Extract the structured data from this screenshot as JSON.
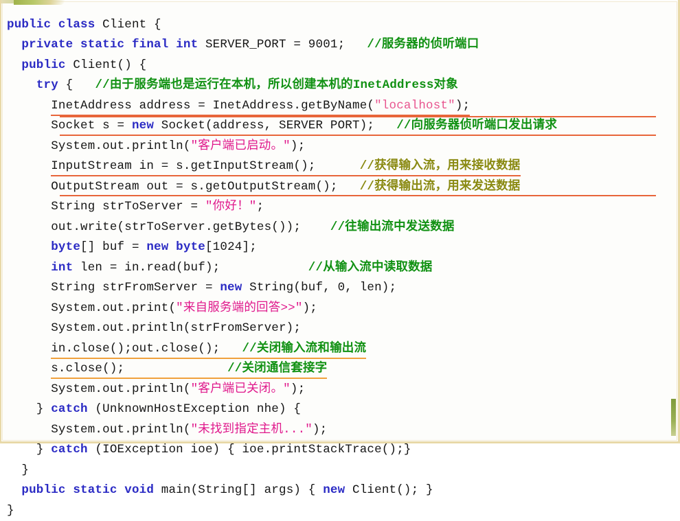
{
  "slide": {
    "language": "java",
    "class_name": "Client",
    "colors": {
      "background": "#fdfdfb",
      "border": "#e8d9a8",
      "keyword": "#2b2bc4",
      "string": "#e0198c",
      "comment_green": "#119113",
      "comment_olive": "#8a8a12",
      "underline_red": "#e8653a",
      "underline_orange": "#f0a13c",
      "accent_green": "#7f9b3c"
    }
  },
  "code": {
    "lines": [
      {
        "id": "line-class-decl",
        "indent": 0,
        "parts": [
          {
            "t": "public",
            "c": "kw"
          },
          {
            "t": " ",
            "c": "pl"
          },
          {
            "t": "class",
            "c": "kw"
          },
          {
            "t": " Client {",
            "c": "pl"
          }
        ]
      },
      {
        "id": "line-server-port",
        "indent": 1,
        "parts": [
          {
            "t": "private",
            "c": "kw"
          },
          {
            "t": " ",
            "c": "pl"
          },
          {
            "t": "static",
            "c": "kw"
          },
          {
            "t": " ",
            "c": "pl"
          },
          {
            "t": "final",
            "c": "kw"
          },
          {
            "t": " ",
            "c": "pl"
          },
          {
            "t": "int",
            "c": "kw"
          },
          {
            "t": " SERVER_PORT = 9001;   ",
            "c": "pl"
          },
          {
            "t": "//服务器的侦听端口",
            "c": "cmt-g"
          }
        ]
      },
      {
        "id": "line-ctor",
        "indent": 1,
        "parts": [
          {
            "t": "public",
            "c": "kw"
          },
          {
            "t": " Client() {",
            "c": "pl"
          }
        ]
      },
      {
        "id": "line-try",
        "indent": 2,
        "parts": [
          {
            "t": "try",
            "c": "kw"
          },
          {
            "t": " {   ",
            "c": "pl"
          },
          {
            "t": "//由于服务端也是运行在本机，所以创建本机的InetAddress对象",
            "c": "cmt-g"
          }
        ]
      },
      {
        "id": "line-inetaddress",
        "indent": 3,
        "underline": "red",
        "parts": [
          {
            "t": "InetAddress address = InetAddress.getByName(",
            "c": "pl"
          },
          {
            "t": "\"localhost\"",
            "c": "strl"
          },
          {
            "t": ");",
            "c": "pl"
          }
        ]
      },
      {
        "id": "line-socket",
        "indent": 3,
        "rule_top": true,
        "rule_bottom": true,
        "parts": [
          {
            "t": "Socket s = ",
            "c": "pl"
          },
          {
            "t": "new",
            "c": "kw"
          },
          {
            "t": " Socket(address, SERVER PORT);   ",
            "c": "pl"
          },
          {
            "t": "//向服务器侦听端口发出请求",
            "c": "cmt-g"
          }
        ]
      },
      {
        "id": "line-println-started",
        "indent": 3,
        "parts": [
          {
            "t": "System.out.println(",
            "c": "pl"
          },
          {
            "t": "\"客户端已启动。\"",
            "c": "str"
          },
          {
            "t": ");",
            "c": "pl"
          }
        ]
      },
      {
        "id": "line-inputstream",
        "indent": 3,
        "underline": "red",
        "parts": [
          {
            "t": "InputStream in = s.getInputStream();      ",
            "c": "pl"
          },
          {
            "t": "//获得输入流，用来接收数据",
            "c": "cmt-o"
          }
        ]
      },
      {
        "id": "line-outputstream",
        "indent": 3,
        "rule_bottom": true,
        "parts": [
          {
            "t": "OutputStream out = s.getOutputStream();   ",
            "c": "pl"
          },
          {
            "t": "//获得输出流，用来发送数据",
            "c": "cmt-o"
          }
        ]
      },
      {
        "id": "line-strtoserver",
        "indent": 3,
        "parts": [
          {
            "t": "String strToServer = ",
            "c": "pl"
          },
          {
            "t": "\"你好！\"",
            "c": "str"
          },
          {
            "t": ";",
            "c": "pl"
          }
        ]
      },
      {
        "id": "line-out-write",
        "indent": 3,
        "parts": [
          {
            "t": "out.write(strToServer.getBytes());    ",
            "c": "pl"
          },
          {
            "t": "//往输出流中发送数据",
            "c": "cmt-g"
          }
        ]
      },
      {
        "id": "line-buf",
        "indent": 3,
        "parts": [
          {
            "t": "byte",
            "c": "kw"
          },
          {
            "t": "[] buf = ",
            "c": "pl"
          },
          {
            "t": "new",
            "c": "kw"
          },
          {
            "t": " ",
            "c": "pl"
          },
          {
            "t": "byte",
            "c": "kw"
          },
          {
            "t": "[1024];",
            "c": "pl"
          }
        ]
      },
      {
        "id": "line-len-read",
        "indent": 3,
        "parts": [
          {
            "t": "int",
            "c": "kw"
          },
          {
            "t": " len = in.read(buf);            ",
            "c": "pl"
          },
          {
            "t": "//从输入流中读取数据",
            "c": "cmt-g"
          }
        ]
      },
      {
        "id": "line-strfromserver",
        "indent": 3,
        "parts": [
          {
            "t": "String strFromServer = ",
            "c": "pl"
          },
          {
            "t": "new",
            "c": "kw"
          },
          {
            "t": " String(buf, 0, len);",
            "c": "pl"
          }
        ]
      },
      {
        "id": "line-print-reply",
        "indent": 3,
        "parts": [
          {
            "t": "System.out.print(",
            "c": "pl"
          },
          {
            "t": "\"来自服务端的回答>>\"",
            "c": "str"
          },
          {
            "t": ");",
            "c": "pl"
          }
        ]
      },
      {
        "id": "line-println-from",
        "indent": 3,
        "parts": [
          {
            "t": "System.out.println(strFromServer);",
            "c": "pl"
          }
        ]
      },
      {
        "id": "line-close-streams",
        "indent": 3,
        "underline": "orange",
        "parts": [
          {
            "t": "in.close();out.close();   ",
            "c": "pl"
          },
          {
            "t": "//关闭输入流和输出流",
            "c": "cmt-g"
          }
        ]
      },
      {
        "id": "line-close-socket",
        "indent": 3,
        "underline": "orange",
        "parts": [
          {
            "t": "s.close();              ",
            "c": "pl"
          },
          {
            "t": "//关闭通信套接字",
            "c": "cmt-g"
          }
        ]
      },
      {
        "id": "line-println-closed",
        "indent": 3,
        "parts": [
          {
            "t": "System.out.println(",
            "c": "pl"
          },
          {
            "t": "\"客户端已关闭。\"",
            "c": "str"
          },
          {
            "t": ");",
            "c": "pl"
          }
        ]
      },
      {
        "id": "line-catch-unknownhost",
        "indent": 2,
        "parts": [
          {
            "t": "} ",
            "c": "pl"
          },
          {
            "t": "catch",
            "c": "kw"
          },
          {
            "t": " (UnknownHostException nhe) {",
            "c": "pl"
          }
        ]
      },
      {
        "id": "line-println-nohost",
        "indent": 3,
        "parts": [
          {
            "t": "System.out.println(",
            "c": "pl"
          },
          {
            "t": "\"未找到指定主机...\"",
            "c": "str"
          },
          {
            "t": ");",
            "c": "pl"
          }
        ]
      },
      {
        "id": "line-catch-ioexception",
        "indent": 2,
        "parts": [
          {
            "t": "} ",
            "c": "pl"
          },
          {
            "t": "catch",
            "c": "kw"
          },
          {
            "t": " (IOException ioe) { ioe.printStackTrace();}",
            "c": "pl"
          }
        ]
      },
      {
        "id": "line-close-ctor",
        "indent": 1,
        "parts": [
          {
            "t": "}",
            "c": "pl"
          }
        ]
      },
      {
        "id": "line-main",
        "indent": 1,
        "parts": [
          {
            "t": "public",
            "c": "kw"
          },
          {
            "t": " ",
            "c": "pl"
          },
          {
            "t": "static",
            "c": "kw"
          },
          {
            "t": " ",
            "c": "pl"
          },
          {
            "t": "void",
            "c": "kw"
          },
          {
            "t": " main(String[] args) { ",
            "c": "pl"
          },
          {
            "t": "new",
            "c": "kw"
          },
          {
            "t": " Client(); }",
            "c": "pl"
          }
        ]
      },
      {
        "id": "line-close-class",
        "indent": 0,
        "parts": [
          {
            "t": "}",
            "c": "pl"
          }
        ]
      }
    ]
  }
}
